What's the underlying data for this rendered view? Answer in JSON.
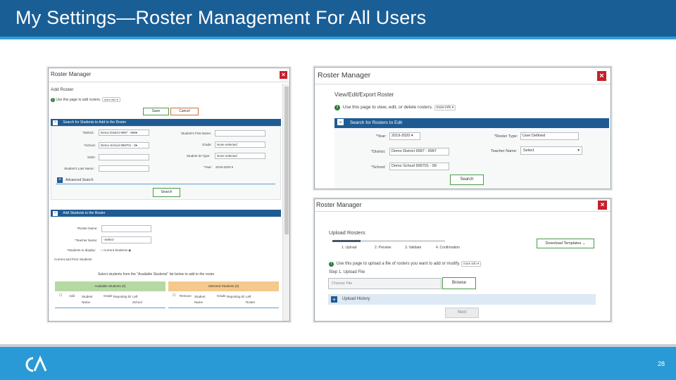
{
  "slide": {
    "title": "My Settings—Roster Management For All Users",
    "page_number": "28",
    "colors": {
      "title_bar": "#1a5e96",
      "footer": "#2a9ad6",
      "section_header": "#1f5b93",
      "close": "#c6202a"
    },
    "logo_icon": "ca-logo-icon"
  },
  "left": {
    "window_title": "Roster Manager",
    "close": "×",
    "heading": "Add Roster",
    "info_text": "Use this page to add rosters.",
    "more_info": "more info ▾",
    "save": "Save",
    "cancel": "Cancel",
    "search_section": "Search for Students to Add to the Roster",
    "district_label": "*District:",
    "district_value": "Demo District 9997 - 999▾",
    "school_label": "*School:",
    "school_value": "Demo School 999701 - 9▾",
    "ssid_label": "SSID:",
    "last_name_label": "Student's Last Name:",
    "first_name_label": "Student's First Name:",
    "grade_label": "Grade:",
    "grade_value": "None selected",
    "id_type_label": "Student ID Type:",
    "id_type_value": "None selected",
    "year_label": "*Year:",
    "year_value": "2019-2020 ▾",
    "advanced_search": "Advanced Search",
    "search": "Search",
    "add_section": "Add Students to the Roster",
    "roster_name_label": "*Roster Name:",
    "teacher_name_label": "*Teacher Name:",
    "teacher_name_value": "-Select-",
    "students_display_label": "*Students to display:",
    "current_students": "Current Students",
    "current_prior": "Current and Prior Students",
    "select_instruction": "Select students from the \"Available Students\" list below to add to the roster",
    "available_header": "Available Students (0)",
    "selected_header": "Selected Students (0)",
    "available_cols": [
      "Add",
      "Student Name",
      "Grade",
      "Reporting ID",
      "Left School"
    ],
    "selected_cols": [
      "Remove",
      "Student Name",
      "Grade",
      "Reporting ID",
      "Left Roster"
    ]
  },
  "topright": {
    "window_title": "Roster Manager",
    "close": "×",
    "heading": "View/Edit/Export Roster",
    "info_text": "Use this page to view, edit, or delete rosters.",
    "more_info": "more info ▾",
    "section": "Search for Rosters to Edit",
    "year_label": "*Year:",
    "year_value": "2019-2020",
    "district_label": "*District:",
    "district_value": "Demo District 9997 - 9997",
    "school_label": "*School:",
    "school_value": "Demo School 999701 - 99",
    "roster_type_label": "*Roster Type:",
    "roster_type_value": "User Defined",
    "teacher_label": "Teacher Name:",
    "teacher_value": "Select",
    "search": "Search"
  },
  "bottomright": {
    "window_title": "Roster Manager",
    "close": "×",
    "heading": "Upload Rosters",
    "steps": [
      "1. Upload",
      "2. Preview",
      "3. Validate",
      "4. Confirmation"
    ],
    "download_templates": "Download Templates",
    "info_text": "Use this page to upload a file of rosters you want to add or modify.",
    "more_info": "more info ▾",
    "step_label": "Step 1. Upload File",
    "choose_file": "Choose File",
    "browse": "Browse",
    "upload_history": "Upload History",
    "next": "Next"
  }
}
